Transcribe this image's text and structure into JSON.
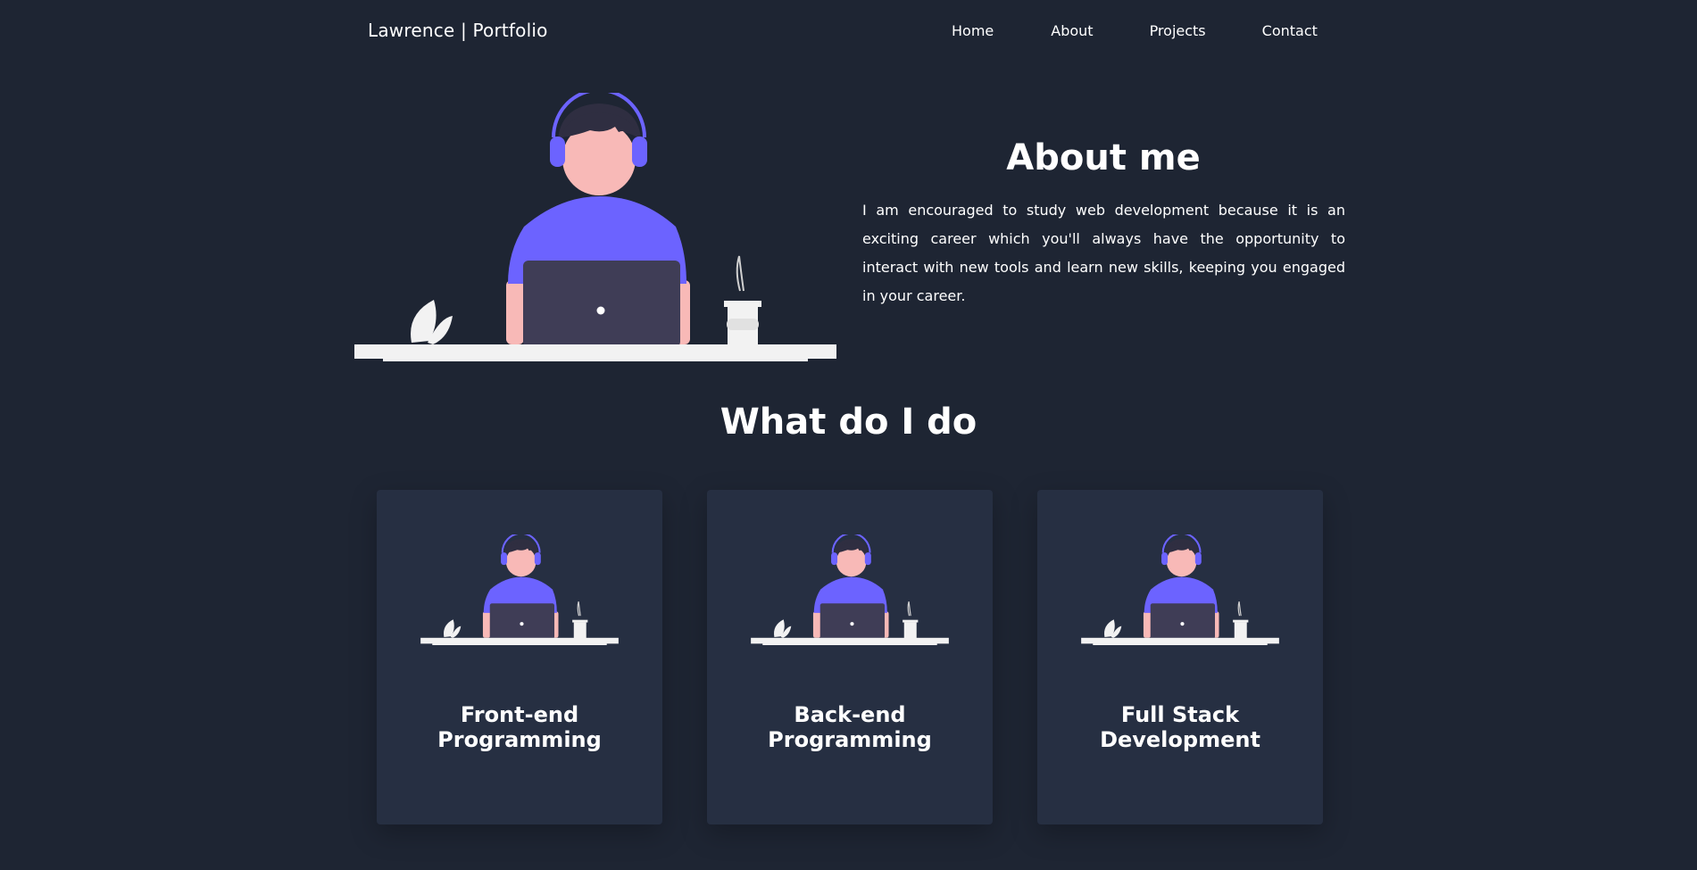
{
  "nav": {
    "brand": "Lawrence | Portfolio",
    "links": [
      "Home",
      "About",
      "Projects",
      "Contact"
    ]
  },
  "about": {
    "title": "About me",
    "text": "I am encouraged to study web development because it is an exciting career which you'll always have the opportunity to interact with new tools and learn new skills, keeping you engaged in your career."
  },
  "services": {
    "title": "What do I do",
    "items": [
      {
        "title_line1": "Front-end",
        "title_line2": "Programming"
      },
      {
        "title_line1": "Back-end",
        "title_line2": "Programming"
      },
      {
        "title_line1": "Full Stack",
        "title_line2": "Development"
      }
    ]
  },
  "colors": {
    "background": "#1e2533",
    "card": "#262f42",
    "accent": "#6c63ff",
    "skin": "#f8b9b7",
    "laptop": "#3f3d56",
    "desk": "#f2f2f2"
  },
  "icons": [
    "developer-illustration",
    "headphones-icon",
    "laptop-icon",
    "coffee-cup-icon",
    "plant-leaf-icon"
  ]
}
